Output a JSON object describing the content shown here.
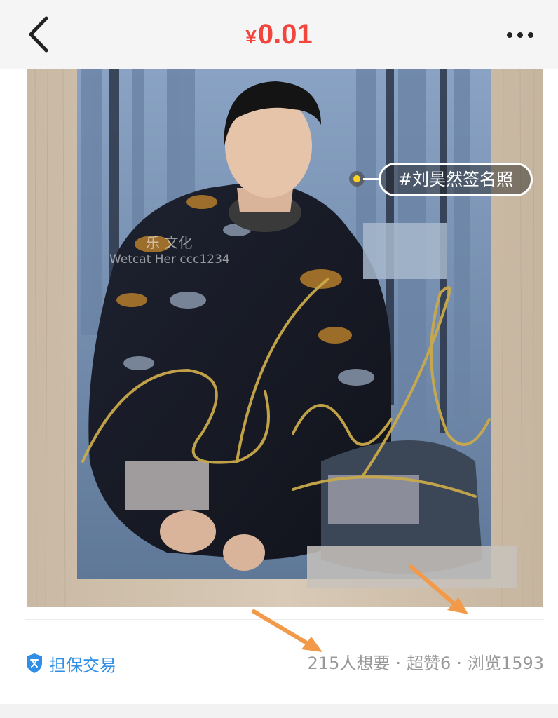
{
  "header": {
    "currency": "¥",
    "price": "0.01",
    "back_icon": "chevron-left-icon",
    "more_icon": "more-dots-icon"
  },
  "photo": {
    "tag_label": "#刘昊然签名照",
    "watermark_brand": "乐  文化",
    "watermark_id": "Wetcat   Her  ccc1234"
  },
  "info_bar": {
    "guarantee_label": "担保交易",
    "guarantee_icon": "shield-icon",
    "wants": "215人想要",
    "likes": "超赞6",
    "views": "浏览1593",
    "separator": "·"
  },
  "colors": {
    "price": "#f2453d",
    "guarantee": "#2f8ee6",
    "stats": "#999999",
    "annotation_arrow": "#f29a4a"
  }
}
